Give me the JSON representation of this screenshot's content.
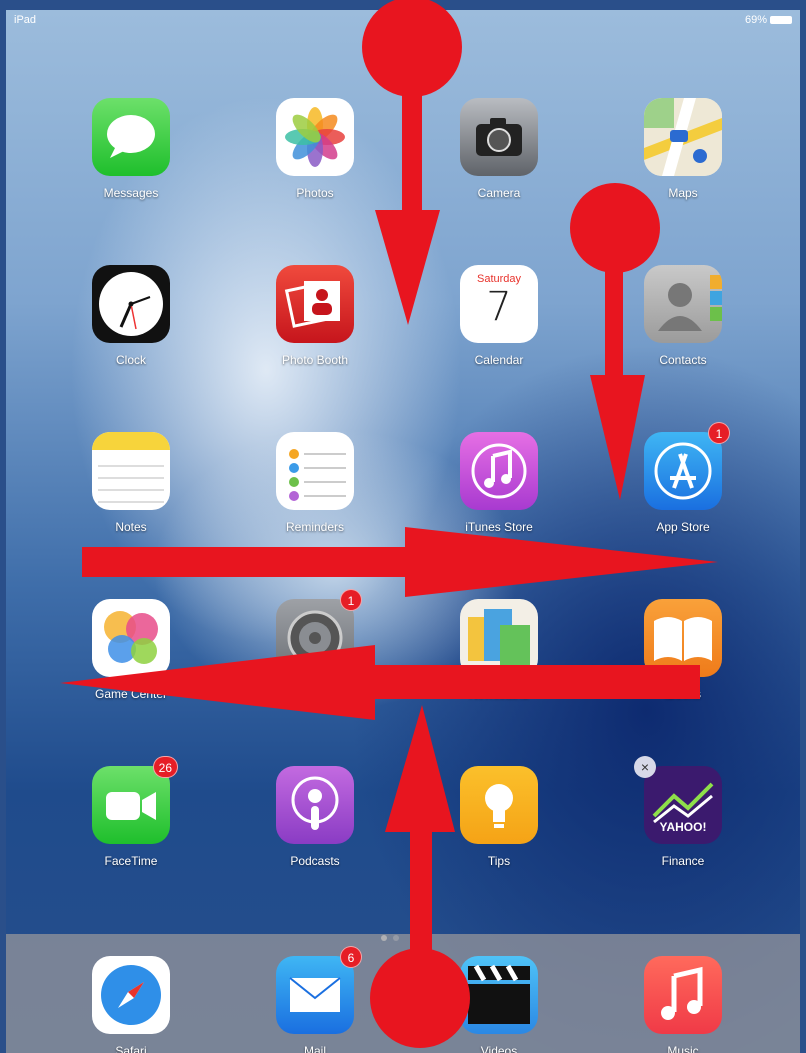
{
  "status_bar": {
    "device": "iPad",
    "battery": "69%"
  },
  "apps": {
    "messages": {
      "label": "Messages"
    },
    "photos": {
      "label": "Photos"
    },
    "camera": {
      "label": "Camera"
    },
    "maps": {
      "label": "Maps"
    },
    "clock": {
      "label": "Clock"
    },
    "photo_booth": {
      "label": "Photo Booth"
    },
    "calendar": {
      "label": "Calendar",
      "weekday": "Saturday",
      "day": "7"
    },
    "contacts": {
      "label": "Contacts"
    },
    "notes": {
      "label": "Notes"
    },
    "reminders": {
      "label": "Reminders"
    },
    "itunes_store": {
      "label": "iTunes Store"
    },
    "app_store": {
      "label": "App Store",
      "badge": "1"
    },
    "game_center": {
      "label": "Game Center"
    },
    "settings": {
      "label": "Settings",
      "badge": "1"
    },
    "newsstand": {
      "label": "Newsstand"
    },
    "ibooks": {
      "label": "iBooks"
    },
    "facetime": {
      "label": "FaceTime",
      "badge": "26"
    },
    "podcasts": {
      "label": "Podcasts"
    },
    "tips": {
      "label": "Tips"
    },
    "finance": {
      "label": "Finance",
      "logo_text": "YAHOO!",
      "delete_mark": "×"
    }
  },
  "dock": {
    "safari": {
      "label": "Safari"
    },
    "mail": {
      "label": "Mail",
      "badge": "6"
    },
    "videos": {
      "label": "Videos"
    },
    "music": {
      "label": "Music"
    }
  },
  "page_indicator": {
    "pages": 2,
    "current": 1
  },
  "annotations": {
    "color": "#e8151f"
  }
}
